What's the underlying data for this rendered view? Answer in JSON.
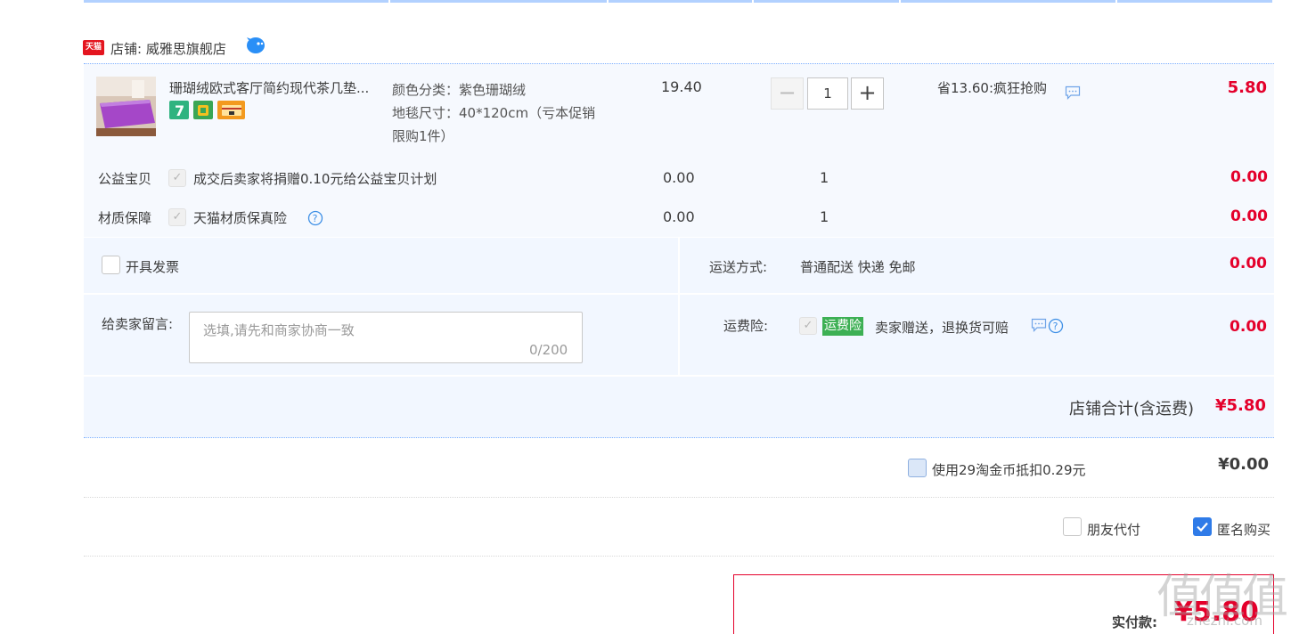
{
  "shop": {
    "badge": "天猫",
    "label": "店铺: 威雅思旗舰店"
  },
  "item": {
    "title": "珊瑚绒欧式客厅简约现代茶几垫...",
    "sku_color": "颜色分类：紫色珊瑚绒",
    "sku_size": "地毯尺寸：40*120cm（亏本促销限购1件）",
    "price": "19.40",
    "quantity": "1",
    "promo": "省13.60:疯狂抢购",
    "total": "5.80"
  },
  "services": [
    {
      "label": "公益宝贝",
      "text": "成交后卖家将捐赠0.10元给公益宝贝计划",
      "price": "0.00",
      "qty": "1",
      "total": "0.00"
    },
    {
      "label": "材质保障",
      "text": "天猫材质保真险",
      "price": "0.00",
      "qty": "1",
      "total": "0.00"
    }
  ],
  "invoice": {
    "label": "开具发票"
  },
  "shipping": {
    "label": "运送方式:",
    "value": "普通配送 快递 免邮",
    "total": "0.00"
  },
  "message": {
    "label": "给卖家留言:",
    "placeholder": "选填,请先和商家协商一致",
    "count": "0/200"
  },
  "insurance": {
    "label": "运费险:",
    "tag": "运费险",
    "text": "卖家赠送，退换货可赔",
    "total": "0.00"
  },
  "shop_total": {
    "label": "店铺合计(含运费)",
    "value": "¥5.80"
  },
  "coin": {
    "label": "使用29淘金币抵扣0.29元",
    "value": "¥0.00"
  },
  "options": {
    "friend_pay": "朋友代付",
    "anonymous": "匿名购买"
  },
  "pay": {
    "label": "实付款:",
    "value": "¥5.80"
  },
  "watermark": {
    "main": "值值值",
    "sub": "zhezhi.com"
  },
  "colors": {
    "accent_red": "#e4002b",
    "tmall_red": "#e4151f",
    "link_blue": "#2f7be8",
    "insurance_green": "#3db054"
  }
}
